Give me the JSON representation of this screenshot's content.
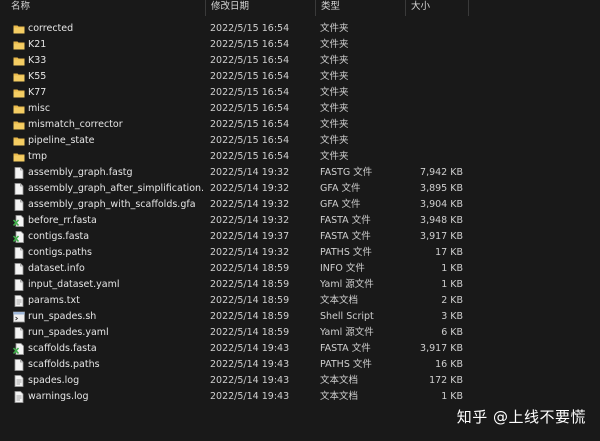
{
  "columns": {
    "name": "名称",
    "date": "修改日期",
    "type": "类型",
    "size": "大小"
  },
  "files": [
    {
      "name": "corrected",
      "date": "2022/5/15 16:54",
      "type": "文件夹",
      "size": "",
      "icon": "folder-icon"
    },
    {
      "name": "K21",
      "date": "2022/5/15 16:54",
      "type": "文件夹",
      "size": "",
      "icon": "folder-icon"
    },
    {
      "name": "K33",
      "date": "2022/5/15 16:54",
      "type": "文件夹",
      "size": "",
      "icon": "folder-icon"
    },
    {
      "name": "K55",
      "date": "2022/5/15 16:54",
      "type": "文件夹",
      "size": "",
      "icon": "folder-icon"
    },
    {
      "name": "K77",
      "date": "2022/5/15 16:54",
      "type": "文件夹",
      "size": "",
      "icon": "folder-icon"
    },
    {
      "name": "misc",
      "date": "2022/5/15 16:54",
      "type": "文件夹",
      "size": "",
      "icon": "folder-icon"
    },
    {
      "name": "mismatch_corrector",
      "date": "2022/5/15 16:54",
      "type": "文件夹",
      "size": "",
      "icon": "folder-icon"
    },
    {
      "name": "pipeline_state",
      "date": "2022/5/15 16:54",
      "type": "文件夹",
      "size": "",
      "icon": "folder-icon"
    },
    {
      "name": "tmp",
      "date": "2022/5/15 16:54",
      "type": "文件夹",
      "size": "",
      "icon": "folder-icon"
    },
    {
      "name": "assembly_graph.fastg",
      "date": "2022/5/14 19:32",
      "type": "FASTG 文件",
      "size": "7,942 KB",
      "icon": "file-icon"
    },
    {
      "name": "assembly_graph_after_simplification....",
      "date": "2022/5/14 19:32",
      "type": "GFA 文件",
      "size": "3,895 KB",
      "icon": "file-icon"
    },
    {
      "name": "assembly_graph_with_scaffolds.gfa",
      "date": "2022/5/14 19:32",
      "type": "GFA 文件",
      "size": "3,904 KB",
      "icon": "file-icon"
    },
    {
      "name": "before_rr.fasta",
      "date": "2022/5/14 19:32",
      "type": "FASTA 文件",
      "size": "3,948 KB",
      "icon": "fasta-icon"
    },
    {
      "name": "contigs.fasta",
      "date": "2022/5/14 19:37",
      "type": "FASTA 文件",
      "size": "3,917 KB",
      "icon": "fasta-icon"
    },
    {
      "name": "contigs.paths",
      "date": "2022/5/14 19:32",
      "type": "PATHS 文件",
      "size": "17 KB",
      "icon": "file-icon"
    },
    {
      "name": "dataset.info",
      "date": "2022/5/14 18:59",
      "type": "INFO 文件",
      "size": "1 KB",
      "icon": "file-icon"
    },
    {
      "name": "input_dataset.yaml",
      "date": "2022/5/14 18:59",
      "type": "Yaml 源文件",
      "size": "1 KB",
      "icon": "file-icon"
    },
    {
      "name": "params.txt",
      "date": "2022/5/14 18:59",
      "type": "文本文档",
      "size": "2 KB",
      "icon": "text-icon"
    },
    {
      "name": "run_spades.sh",
      "date": "2022/5/14 18:59",
      "type": "Shell Script",
      "size": "3 KB",
      "icon": "script-icon"
    },
    {
      "name": "run_spades.yaml",
      "date": "2022/5/14 18:59",
      "type": "Yaml 源文件",
      "size": "6 KB",
      "icon": "file-icon"
    },
    {
      "name": "scaffolds.fasta",
      "date": "2022/5/14 19:43",
      "type": "FASTA 文件",
      "size": "3,917 KB",
      "icon": "fasta-icon"
    },
    {
      "name": "scaffolds.paths",
      "date": "2022/5/14 19:43",
      "type": "PATHS 文件",
      "size": "16 KB",
      "icon": "file-icon"
    },
    {
      "name": "spades.log",
      "date": "2022/5/14 19:43",
      "type": "文本文档",
      "size": "172 KB",
      "icon": "text-icon"
    },
    {
      "name": "warnings.log",
      "date": "2022/5/14 19:43",
      "type": "文本文档",
      "size": "1 KB",
      "icon": "text-icon"
    }
  ],
  "watermark": "知乎 @上线不要慌",
  "colors": {
    "background": "#191919",
    "folder": "#e8b84a",
    "fasta_accent": "#3fae49"
  }
}
